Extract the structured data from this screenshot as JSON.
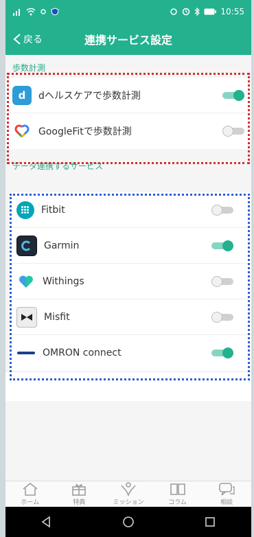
{
  "status_bar": {
    "left_icons": [
      "signal-icon",
      "wifi-icon",
      "notification-icon",
      "shield-icon"
    ],
    "right_icons": [
      "alarm-icon",
      "clock-icon",
      "bluetooth-icon",
      "battery-icon"
    ],
    "time": "10:55"
  },
  "header": {
    "back_label": "戻る",
    "title": "連携サービス設定"
  },
  "sections": [
    {
      "title": "歩数計測",
      "items": [
        {
          "label": "dヘルスケアで歩数計測",
          "icon": "d-healthcare-icon",
          "enabled": true
        },
        {
          "label": "GoogleFitで歩数計測",
          "icon": "google-fit-icon",
          "enabled": false
        }
      ]
    },
    {
      "title": "データ連携するサービス",
      "items": [
        {
          "label": "Fitbit",
          "icon": "fitbit-icon",
          "enabled": false
        },
        {
          "label": "Garmin",
          "icon": "garmin-icon",
          "enabled": true
        },
        {
          "label": "Withings",
          "icon": "withings-icon",
          "enabled": false
        },
        {
          "label": "Misfit",
          "icon": "misfit-icon",
          "enabled": false
        },
        {
          "label": "OMRON connect",
          "icon": "omron-icon",
          "enabled": true
        }
      ]
    }
  ],
  "bottom_nav": [
    {
      "label": "ホーム",
      "icon": "home-icon"
    },
    {
      "label": "特典",
      "icon": "gift-icon"
    },
    {
      "label": "ミッション",
      "icon": "mission-icon"
    },
    {
      "label": "コラム",
      "icon": "book-icon"
    },
    {
      "label": "相談",
      "icon": "chat-icon"
    }
  ],
  "system_nav": [
    "back-triangle-icon",
    "home-circle-icon",
    "recents-square-icon"
  ],
  "colors": {
    "accent": "#23b18e",
    "highlight_red": "#d32f2f",
    "highlight_blue": "#2b5fce"
  }
}
